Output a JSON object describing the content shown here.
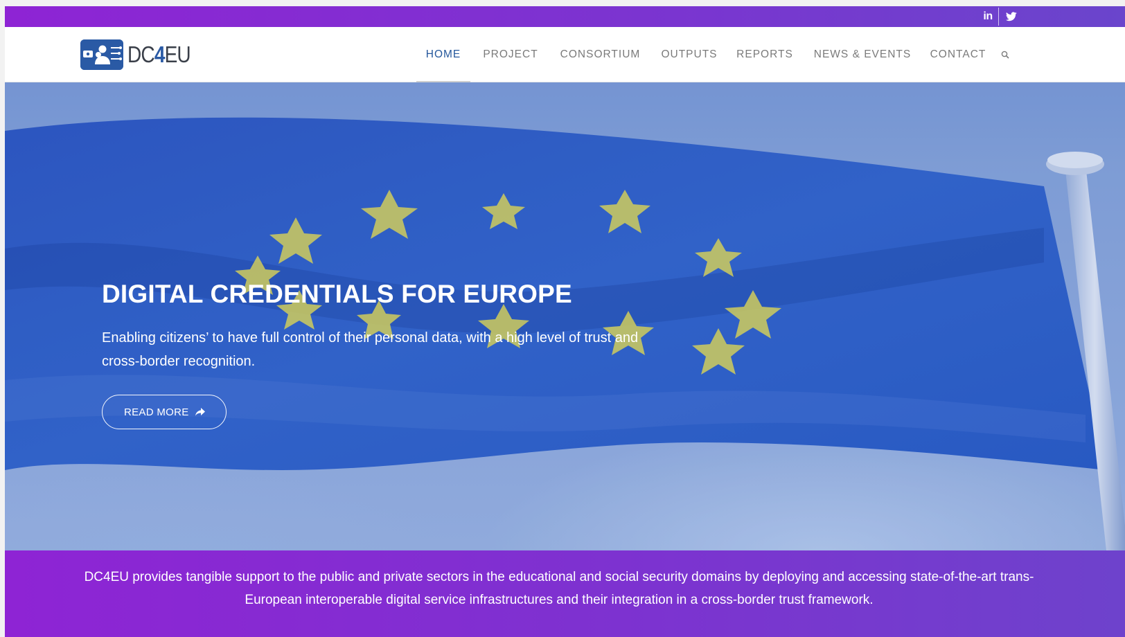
{
  "colors": {
    "brand_purple": "#8e24d4",
    "brand_violet": "#6e42cc",
    "brand_blue": "#2a5aa5",
    "nav_text": "#7a7a7a",
    "nav_active": "#24579c",
    "flag_blue": "#2f62c9",
    "flag_star": "#e6dd4d"
  },
  "topbar": {
    "social": [
      {
        "name": "linkedin",
        "icon": "linkedin-icon",
        "glyph": "in"
      },
      {
        "name": "twitter",
        "icon": "twitter-icon"
      }
    ]
  },
  "header": {
    "logo": {
      "text_prefix": "DC",
      "text_accent": "4",
      "text_suffix": "EU",
      "icon": "credential-badge-icon"
    },
    "nav": [
      {
        "label": "HOME",
        "active": true
      },
      {
        "label": "PROJECT",
        "active": false
      },
      {
        "label": "CONSORTIUM",
        "active": false
      },
      {
        "label": "OUTPUTS",
        "active": false
      },
      {
        "label": "REPORTS",
        "active": false
      },
      {
        "label": "NEWS & EVENTS",
        "active": false
      },
      {
        "label": "CONTACT",
        "active": false
      }
    ],
    "search_icon": "search-icon"
  },
  "hero": {
    "title": "DIGITAL CREDENTIALS FOR EUROPE",
    "subtitle": "Enabling citizens’ to have full control of their personal data, with a high level of trust and cross-border recognition.",
    "button_label": "READ MORE",
    "button_icon": "share-arrow-icon",
    "background": "eu-flag-waving-photo"
  },
  "band": {
    "text": "DC4EU provides tangible support to the public and private sectors in the educational and social security domains by deploying and accessing state-of-the-art trans-European interoperable digital service infrastructures and their integration in a cross-border trust framework."
  }
}
